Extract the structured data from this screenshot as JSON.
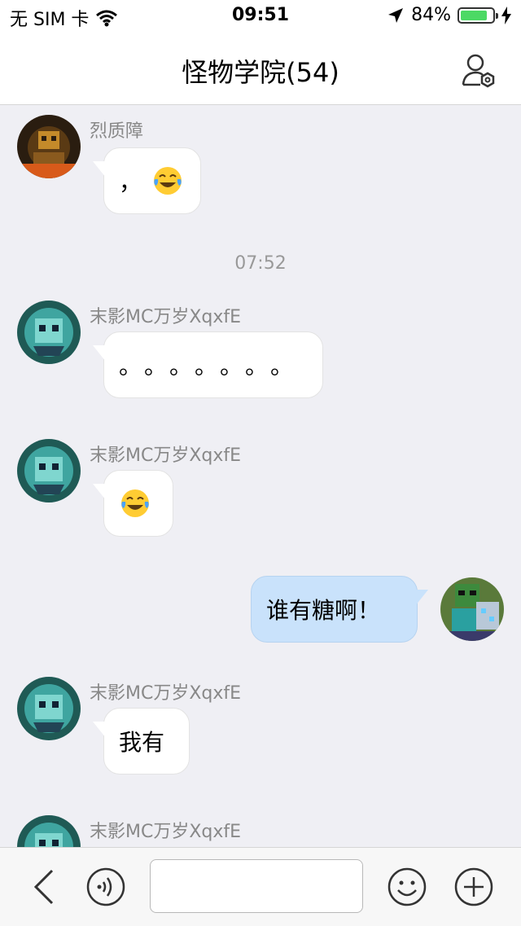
{
  "status_bar": {
    "carrier": "无 SIM 卡",
    "time": "09:51",
    "battery_percent": "84%",
    "battery_level": 0.84,
    "icons": [
      "wifi-icon",
      "location-arrow-icon",
      "battery-icon",
      "charging-bolt-icon"
    ]
  },
  "header": {
    "title": "怪物学院(54)",
    "settings_icon": "group-settings-icon"
  },
  "messages": [
    {
      "sender": "烈质障",
      "text": "，",
      "emoji": "tears-of-joy-emoji",
      "side": "left"
    },
    {
      "timestamp": "07:52"
    },
    {
      "sender": "末影MC万岁XqxfE",
      "text": "。。。。。。。",
      "side": "left"
    },
    {
      "sender": "末影MC万岁XqxfE",
      "emoji": "tears-of-joy-emoji",
      "side": "left"
    },
    {
      "text": "谁有糖啊！",
      "side": "right"
    },
    {
      "sender": "末影MC万岁XqxfE",
      "text": "我有",
      "side": "left"
    },
    {
      "sender": "末影MC万岁XqxfE",
      "side": "left"
    }
  ],
  "toolbar": {
    "icons": [
      "back-chevron-icon",
      "voice-icon",
      "emoji-face-icon",
      "plus-circle-icon"
    ],
    "input_value": ""
  },
  "colors": {
    "background": "#efeff4",
    "own_bubble": "#c9e2fb",
    "other_bubble": "#ffffff",
    "battery_green": "#4cd964"
  }
}
